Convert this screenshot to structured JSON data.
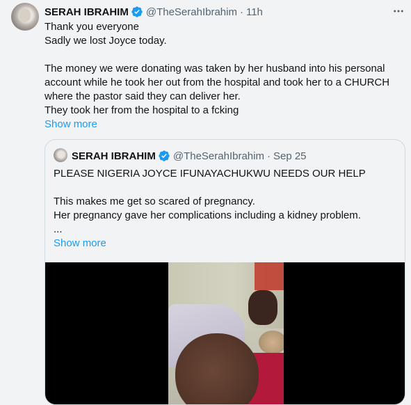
{
  "tweet": {
    "author_name": "SERAH IBRAHIM",
    "handle": "@TheSerahIbrahim",
    "separator": "·",
    "time": "11h",
    "more_icon": "more-horizontal-icon",
    "lines": [
      "Thank you everyone",
      "Sadly we lost Joyce today.",
      "",
      "The money we were donating was taken by her husband into his personal",
      "account while he took her out from the hospital and took her to a CHURCH",
      "where the pastor said they can deliver her.",
      "They took her from the hospital to a fcking"
    ],
    "show_more": "Show more"
  },
  "quote": {
    "author_name": "SERAH IBRAHIM",
    "handle": "@TheSerahIbrahim",
    "separator": "·",
    "time": "Sep 25",
    "lines": [
      "PLEASE NIGERIA JOYCE IFUNAYACHUKWU NEEDS OUR HELP",
      "",
      "This makes me get so scared of pregnancy.",
      "Her pregnancy gave her complications including a kidney problem.",
      "..."
    ],
    "show_more": "Show more"
  },
  "colors": {
    "link": "#1d9bf0",
    "secondary_text": "#536471",
    "verified_badge": "#1d9bf0",
    "background": "#f2f3f4"
  }
}
